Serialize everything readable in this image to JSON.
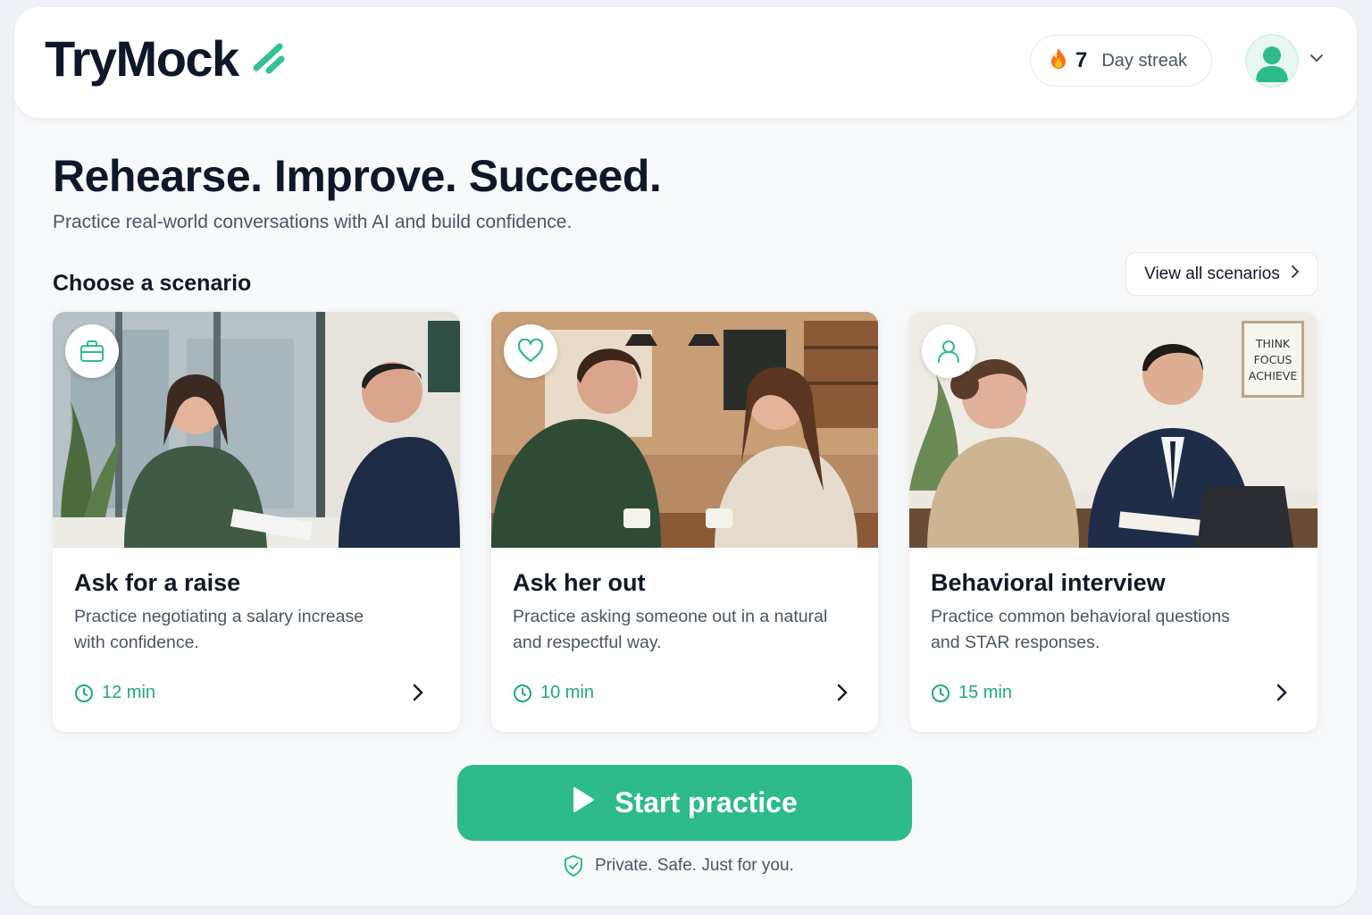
{
  "header": {
    "logo_text": "TryMock",
    "streak_count": "7",
    "streak_label": "Day streak"
  },
  "hero": {
    "title": "Rehearse. Improve. Succeed.",
    "subtitle": "Practice real-world conversations with AI and build confidence."
  },
  "scenarios": {
    "section_title": "Choose a scenario",
    "view_all_label": "View all scenarios",
    "items": [
      {
        "title": "Ask for a raise",
        "description": "Practice negotiating a salary increase with confidence.",
        "duration": "12 min",
        "icon": "briefcase-icon"
      },
      {
        "title": "Ask her out",
        "description": "Practice asking someone out in a natural and respectful way.",
        "duration": "10 min",
        "icon": "heart-icon"
      },
      {
        "title": "Behavioral interview",
        "description": "Practice common behavioral questions and STAR responses.",
        "duration": "15 min",
        "icon": "user-icon",
        "poster_lines": [
          "THINK",
          "FOCUS",
          "ACHIEVE"
        ]
      }
    ]
  },
  "cta": {
    "start_label": "Start practice",
    "privacy_text": "Private. Safe. Just for you."
  },
  "colors": {
    "accent": "#2dbb8b",
    "accent_text": "#1faa79",
    "title": "#0f172a",
    "muted": "#4b5563"
  }
}
